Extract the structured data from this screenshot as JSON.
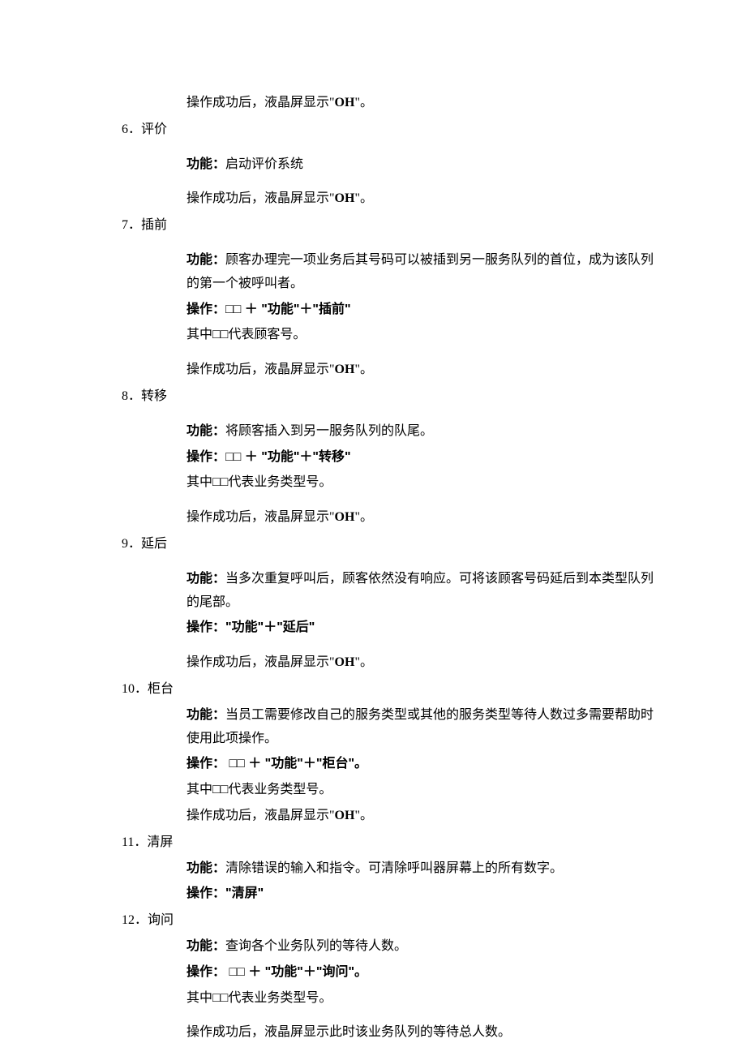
{
  "intro_success": "操作成功后，液晶屏显示\"",
  "oh_text": "OH",
  "quote_end": "\"。",
  "items": {
    "6": {
      "num": "6．",
      "title": "评价",
      "func_label": "功能：",
      "func": "启动评价系统",
      "success_prefix": "操作成功后，液晶屏显示\"",
      "success_suffix": "\"。"
    },
    "7": {
      "num": "7．",
      "title": "插前",
      "func_label": "功能：",
      "func": "顾客办理完一项业务后其号码可以被插到另一服务队列的首位，成为该队列的第一个被呼叫者。",
      "op_label": "操作：",
      "op": "□□ ＋ \"功能\"＋\"插前\"",
      "note": "其中□□代表顾客号。",
      "success_prefix": "操作成功后，液晶屏显示\"",
      "success_suffix": "\"。"
    },
    "8": {
      "num": "8．",
      "title": "转移",
      "func_label": "功能：",
      "func": "将顾客插入到另一服务队列的队尾。",
      "op_label": "操作：",
      "op": "□□ ＋ \"功能\"＋\"转移\"",
      "note": "其中□□代表业务类型号。",
      "success_prefix": "操作成功后，液晶屏显示\"",
      "success_suffix": "\"。"
    },
    "9": {
      "num": "9．",
      "title": "延后",
      "func_label": "功能：",
      "func": "当多次重复呼叫后，顾客依然没有响应。可将该顾客号码延后到本类型队列的尾部。",
      "op_label": "操作：",
      "op": "\"功能\"＋\"延后\"",
      "success_prefix": "操作成功后，液晶屏显示\"",
      "success_suffix": "\"。"
    },
    "10": {
      "num": "10．",
      "title": "柜台",
      "func_label": "功能：",
      "func": "当员工需要修改自己的服务类型或其他的服务类型等待人数过多需要帮助时使用此项操作。",
      "op_label": "操作：",
      "op": " □□ ＋ \"功能\"＋\"柜台\"。",
      "note": "其中□□代表业务类型号。",
      "success_prefix": "操作成功后，液晶屏显示\"",
      "success_suffix": "\"。"
    },
    "11": {
      "num": "11．",
      "title": "清屏",
      "func_label": "功能：",
      "func": "清除错误的输入和指令。可清除呼叫器屏幕上的所有数字。",
      "op_label": "操作：",
      "op": "\"清屏\""
    },
    "12": {
      "num": "12．",
      "title": "询问",
      "func_label": "功能：",
      "func": "查询各个业务队列的等待人数。",
      "op_label": "操作：",
      "op": " □□ ＋ \"功能\"＋\"询问\"。",
      "note": "其中□□代表业务类型号。",
      "success_full": "操作成功后，液晶屏显示此时该业务队列的等待总人数。"
    }
  }
}
